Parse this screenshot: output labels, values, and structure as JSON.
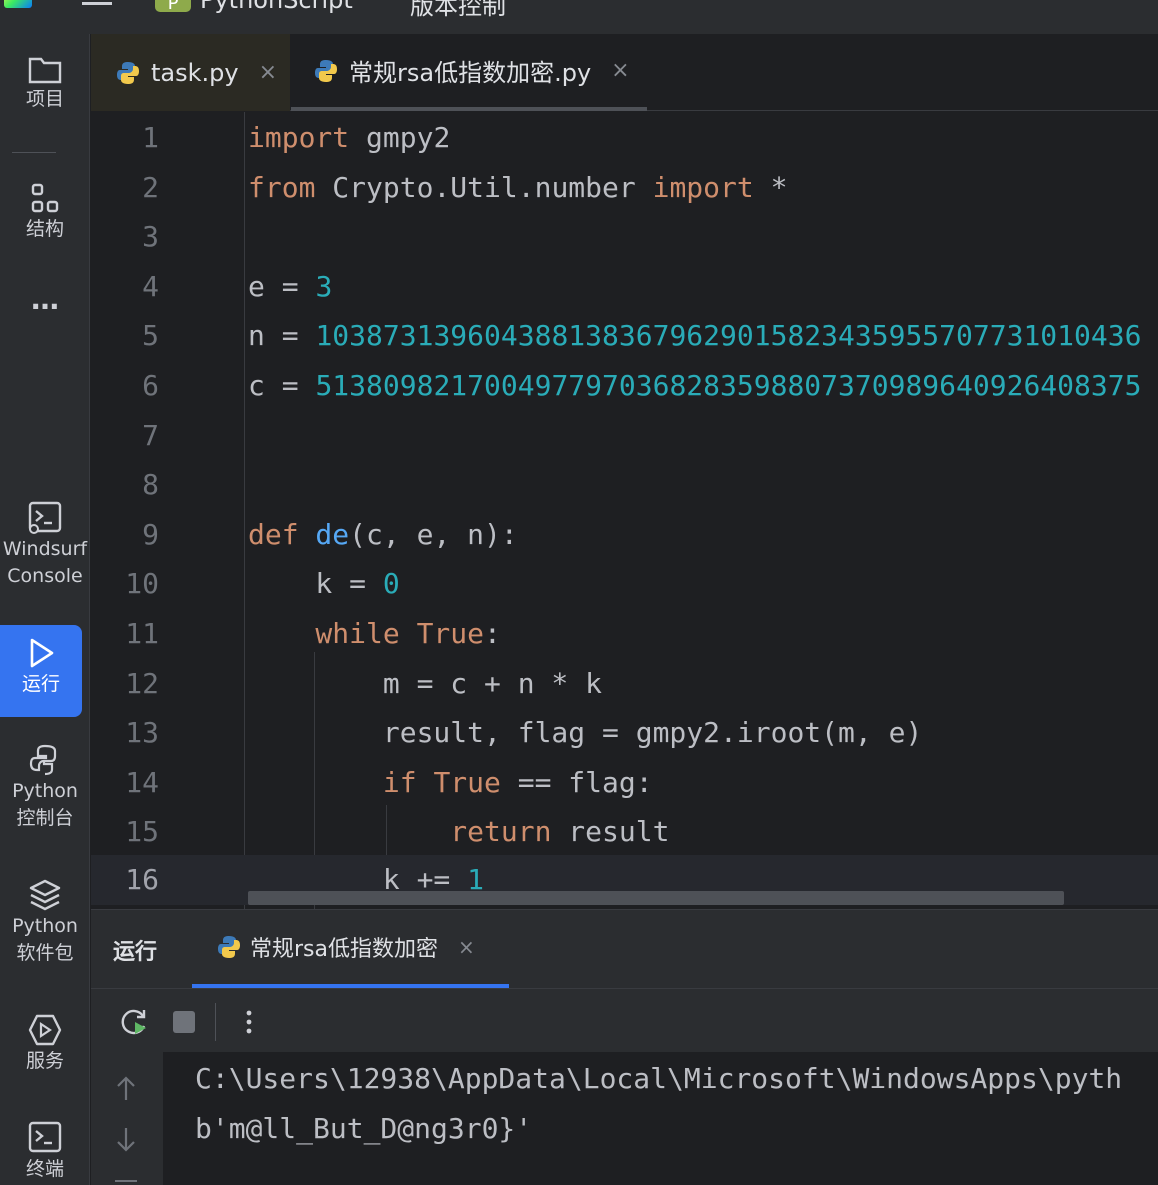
{
  "topbar": {
    "project_badge": "P",
    "project_name": "PythonScript",
    "vcs_label": "版本控制"
  },
  "toolstrip": {
    "items": [
      {
        "label": "项目",
        "icon": "folder-icon"
      },
      {
        "label": "结构",
        "icon": "structure-icon"
      },
      {
        "label": "…",
        "icon": "more-icon"
      },
      {
        "label": "Windsurf Console",
        "icon": "terminal-icon"
      },
      {
        "label": "运行",
        "icon": "run-icon",
        "active": true
      },
      {
        "label": "Python 控制台",
        "icon": "python-icon"
      },
      {
        "label": "Python 软件包",
        "icon": "layers-icon"
      },
      {
        "label": "服务",
        "icon": "services-icon"
      },
      {
        "label": "终端",
        "icon": "terminal-icon"
      }
    ]
  },
  "tabs": [
    {
      "label": "task.py",
      "close": "×"
    },
    {
      "label": "常规rsa低指数加密.py",
      "close": "×"
    }
  ],
  "editor": {
    "lines": [
      {
        "n": "1"
      },
      {
        "n": "2"
      },
      {
        "n": "3"
      },
      {
        "n": "4"
      },
      {
        "n": "5"
      },
      {
        "n": "6"
      },
      {
        "n": "7"
      },
      {
        "n": "8"
      },
      {
        "n": "9"
      },
      {
        "n": "10"
      },
      {
        "n": "11"
      },
      {
        "n": "12"
      },
      {
        "n": "13"
      },
      {
        "n": "14"
      },
      {
        "n": "15"
      },
      {
        "n": "16"
      }
    ],
    "code": {
      "l1_kw": "import",
      "l1_rest": " gmpy2",
      "l2_kw1": "from",
      "l2_mid": " Crypto.Util.number ",
      "l2_kw2": "import",
      "l2_rest": " *",
      "l4_pre": "e = ",
      "l4_num": "3",
      "l5_pre": "n = ",
      "l5_num": "1038731396043881383679629015823435955707731010436",
      "l6_pre": "c = ",
      "l6_num": "5138098217004977970368283598807370989640926408375",
      "l9_kw": "def",
      "l9_fn": " de",
      "l9_rest": "(c, e, n):",
      "l10_pre": "    k = ",
      "l10_num": "0",
      "l11_kw": "    while",
      "l11_sp": " ",
      "l11_kw2": "True",
      "l11_rest": ":",
      "l12": "        m = c + n * k",
      "l13": "        result, flag = gmpy2.iroot(m, e)",
      "l14_kw": "        if",
      "l14_sp": " ",
      "l14_kw2": "True",
      "l14_rest": " == flag:",
      "l15_kw": "            return",
      "l15_rest": " result",
      "l16_pre": "        k += ",
      "l16_num": "1"
    }
  },
  "run_panel": {
    "title": "运行",
    "tab_label": "常规rsa低指数加密",
    "tab_close": "×",
    "console_lines": [
      "C:\\Users\\12938\\AppData\\Local\\Microsoft\\WindowsApps\\pyth",
      "b'm@ll_But_D@ng3r0}'"
    ]
  }
}
